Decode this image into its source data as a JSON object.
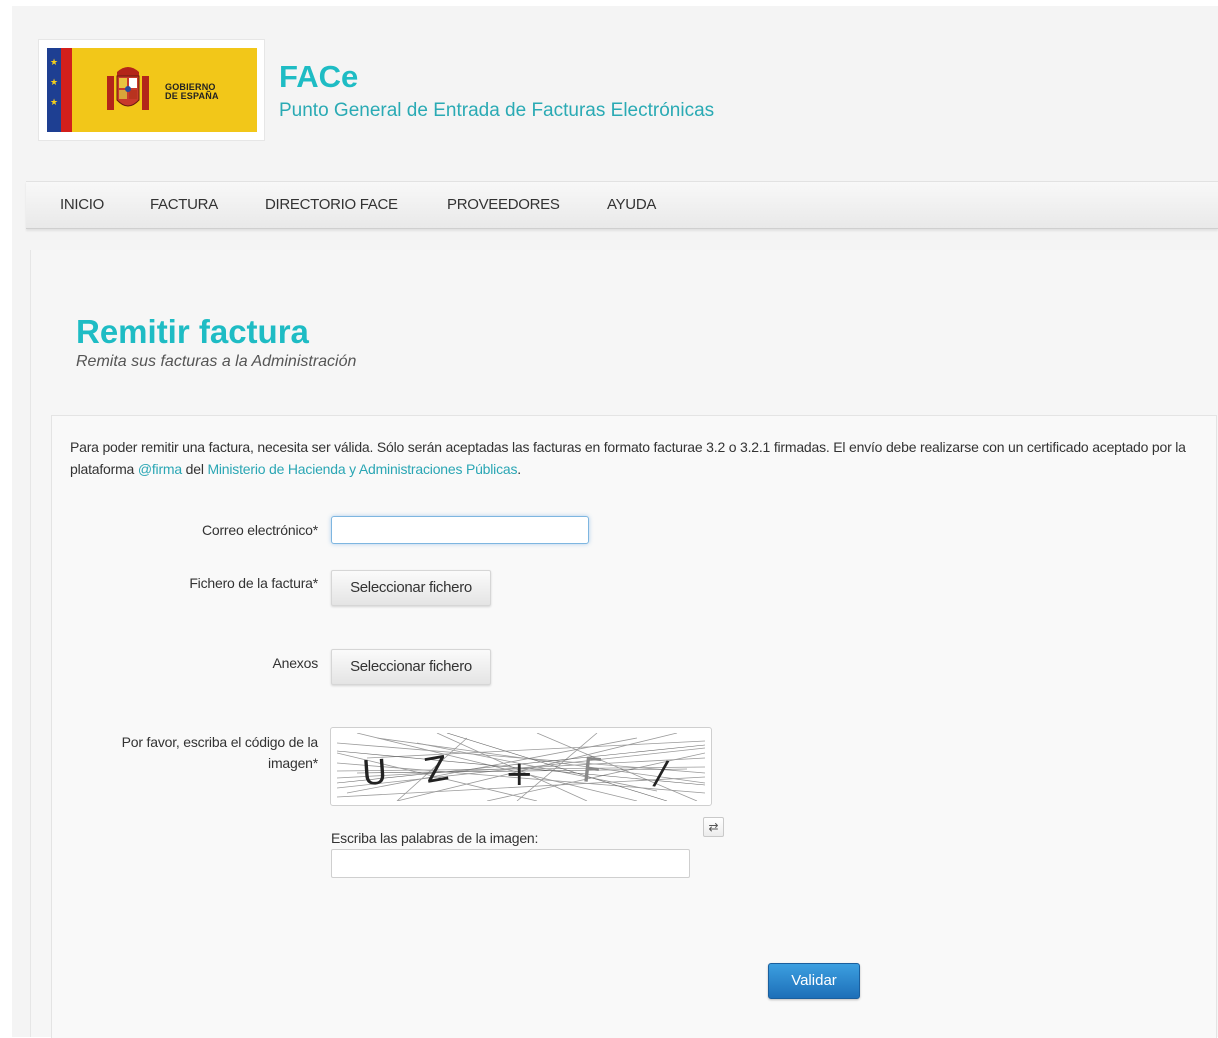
{
  "header": {
    "logo_text_line1": "GOBIERNO",
    "logo_text_line2": "DE ESPAÑA",
    "app_title": "FACe",
    "app_subtitle": "Punto General de Entrada de Facturas Electrónicas"
  },
  "nav": {
    "items": [
      {
        "label": "INICIO"
      },
      {
        "label": "FACTURA"
      },
      {
        "label": "DIRECTORIO FACE"
      },
      {
        "label": "PROVEEDORES"
      },
      {
        "label": "AYUDA"
      }
    ]
  },
  "page": {
    "title": "Remitir factura",
    "subtitle": "Remita sus facturas a la Administración"
  },
  "intro": {
    "text_before": "Para poder remitir una factura, necesita ser válida. Sólo serán aceptadas las facturas en formato facturae 3.2 o 3.2.1 firmadas. El envío debe realizarse con un certificado aceptado por la plataforma ",
    "link1": "@firma",
    "text_middle": " del ",
    "link2": "Ministerio de Hacienda y Administraciones Públicas",
    "text_after": "."
  },
  "form": {
    "email_label": "Correo electrónico*",
    "email_value": "",
    "invoice_file_label": "Fichero de la factura*",
    "invoice_file_button": "Seleccionar fichero",
    "annex_label": "Anexos",
    "annex_button": "Seleccionar fichero",
    "captcha_label": "Por favor, escriba el código de la imagen*",
    "captcha_prompt": "Escriba las palabras de la imagen:",
    "captcha_value": "",
    "submit_label": "Validar"
  },
  "icons": {
    "refresh": "refresh-icon"
  },
  "colors": {
    "accent": "#1ebcc4",
    "link": "#2aa6b4",
    "button_primary": "#1d6fb8",
    "logo_yellow": "#f2c719",
    "flag_blue": "#1e3f92",
    "flag_red": "#d21f1b"
  }
}
